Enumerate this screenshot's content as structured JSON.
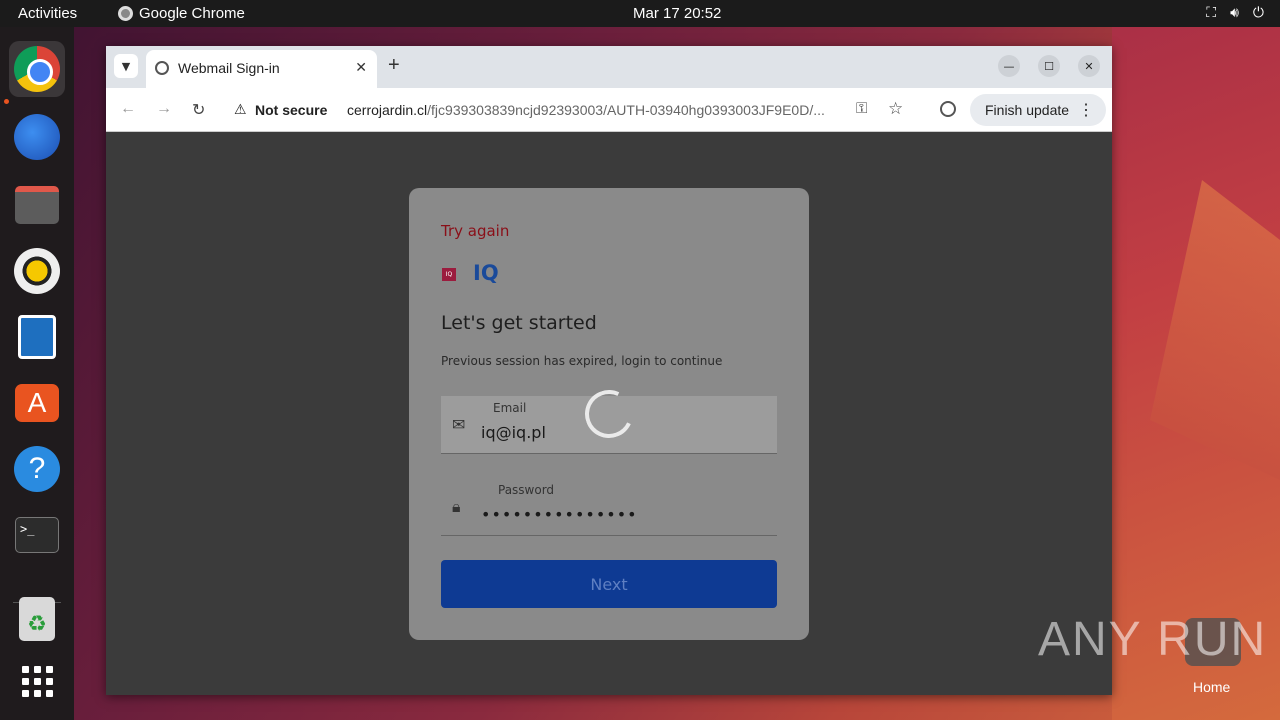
{
  "topbar": {
    "activities": "Activities",
    "app_name": "Google Chrome",
    "clock": "Mar 17  20:52",
    "tray_icons": [
      "network-icon",
      "volume-icon",
      "power-icon"
    ]
  },
  "dock": {
    "items": [
      "chrome",
      "thunderbird",
      "files",
      "rhythmbox",
      "libreoffice-writer",
      "app-center",
      "help",
      "terminal",
      "trash",
      "show-apps"
    ]
  },
  "browser": {
    "tab_title": "Webmail Sign-in",
    "security_label": "Not secure",
    "url_host": "cerrojardin.cl",
    "url_path": "/fjc939303839ncjd92393003/AUTH-03940hg0393003JF9E0D/...",
    "finish_update": "Finish update"
  },
  "login": {
    "try_again": "Try again",
    "logo_small": "IQ",
    "logo_text": "IQ",
    "heading": "Let's get started",
    "subtext": "Previous session has expired, login to continue",
    "email_label": "Email",
    "email_value": "iq@iq.pl",
    "password_label": "Password",
    "password_value": "•••••••••••••••",
    "next_label": "Next"
  },
  "desktop": {
    "watermark": "ANY RUN",
    "home_label": "Home"
  },
  "colors": {
    "accent_ubuntu": "#e95420",
    "error_text": "#8a0f18",
    "next_button": "#0e3a93"
  }
}
